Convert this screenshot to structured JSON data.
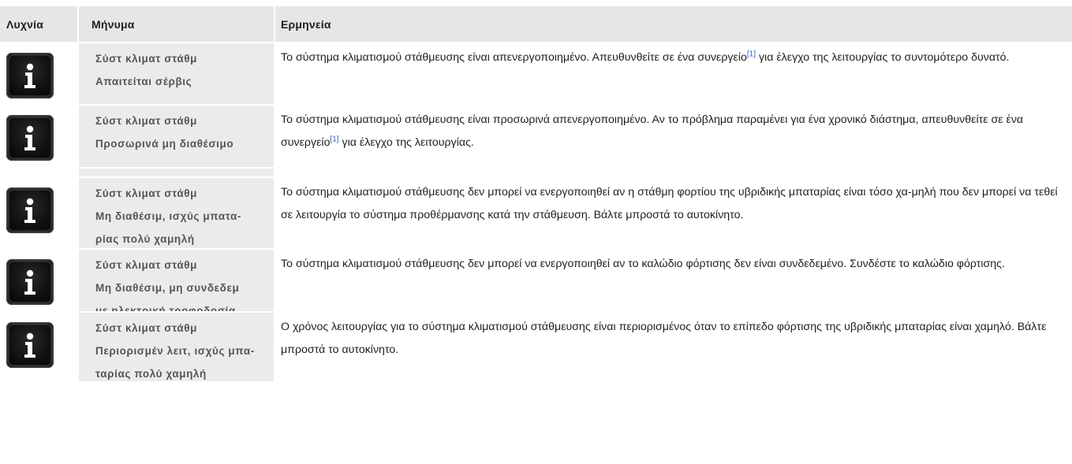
{
  "table": {
    "headers": {
      "lamp": "Λυχνία",
      "message": "Μήνυμα",
      "explanation": "Ερμηνεία"
    },
    "rows": [
      {
        "icon": "info-icon",
        "message_lines": [
          "Σύστ κλιματ στάθμ",
          "Απαιτείται σέρβις"
        ],
        "explanation_before": "Το σύστημα κλιματισμού στάθμευσης είναι απενεργοποιημένο. Απευθυνθείτε σε ένα συνεργείο",
        "footnote": "[1]",
        "explanation_after": " για έλεγχο της λειτουργίας το συντομότερο δυνατό."
      },
      {
        "icon": "info-icon",
        "message_lines": [
          "Σύστ κλιματ στάθμ",
          "Προσωρινά μη διαθέσιμο"
        ],
        "explanation_before": "Το σύστημα κλιματισμού στάθμευσης είναι προσωρινά απενεργοποιημένο. Αν το πρόβλημα παραμένει για ένα χρονικό διάστημα, απευθυνθείτε σε ένα συνεργείο",
        "footnote": "[1]",
        "explanation_after": " για έλεγχο της λειτουργίας."
      },
      {
        "icon": "info-icon",
        "message_lines": [
          "Σύστ κλιματ στάθμ",
          "Μη διαθέσιμ, ισχύς μπατα-",
          "ρίας πολύ χαμηλή"
        ],
        "explanation_before": "Το σύστημα κλιματισμού στάθμευσης δεν μπορεί να ενεργοποιηθεί αν η στάθμη φορτίου της υβριδικής μπαταρίας είναι τόσο χα-μηλή που δεν μπορεί να τεθεί σε λειτουργία το σύστημα προθέρμανσης κατά την στάθμευση. Βάλτε μπροστά το αυτοκίνητο.",
        "footnote": "",
        "explanation_after": ""
      },
      {
        "icon": "info-icon",
        "message_lines": [
          "Σύστ κλιματ στάθμ",
          "Μη διαθέσιμ, μη συνδεδεμ",
          "με ηλεκτρική τροφοδοσία"
        ],
        "explanation_before": "Το σύστημα κλιματισμού στάθμευσης δεν μπορεί να ενεργοποιηθεί αν το καλώδιο φόρτισης δεν είναι συνδεδεμένο. Συνδέστε το καλώδιο φόρτισης.",
        "footnote": "",
        "explanation_after": ""
      },
      {
        "icon": "info-icon",
        "message_lines": [
          "Σύστ κλιματ στάθμ",
          "Περιορισμέν λειτ, ισχύς μπα-",
          "ταρίας πολύ χαμηλή"
        ],
        "explanation_before": "Ο χρόνος λειτουργίας για το σύστημα κλιματισμού στάθμευσης είναι περιορισμένος όταν το επίπεδο φόρτισης της υβριδικής μπαταρίας είναι χαμηλό. Βάλτε μπροστά το αυτοκίνητο.",
        "footnote": "",
        "explanation_after": ""
      }
    ]
  },
  "colors": {
    "header_bg": "#e6e6e6",
    "message_bg": "#ebebeb",
    "message_text": "#555555",
    "footnote_link": "#2a63c7"
  }
}
